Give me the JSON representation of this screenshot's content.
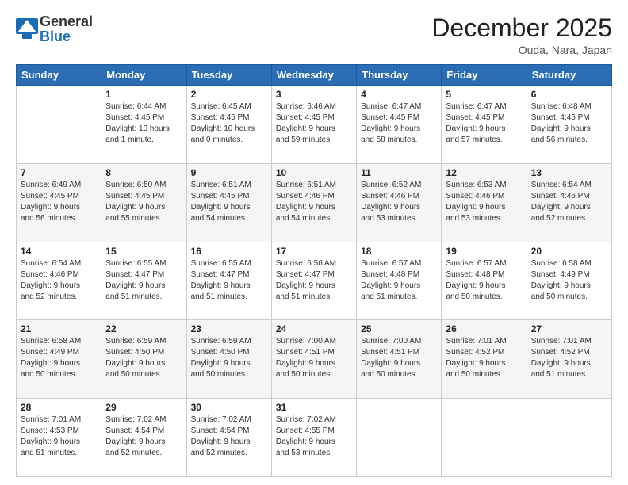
{
  "header": {
    "logo_general": "General",
    "logo_blue": "Blue",
    "month": "December 2025",
    "location": "Ouda, Nara, Japan"
  },
  "days": [
    "Sunday",
    "Monday",
    "Tuesday",
    "Wednesday",
    "Thursday",
    "Friday",
    "Saturday"
  ],
  "weeks": [
    [
      {
        "day": "",
        "info": ""
      },
      {
        "day": "1",
        "info": "Sunrise: 6:44 AM\nSunset: 4:45 PM\nDaylight: 10 hours\nand 1 minute."
      },
      {
        "day": "2",
        "info": "Sunrise: 6:45 AM\nSunset: 4:45 PM\nDaylight: 10 hours\nand 0 minutes."
      },
      {
        "day": "3",
        "info": "Sunrise: 6:46 AM\nSunset: 4:45 PM\nDaylight: 9 hours\nand 59 minutes."
      },
      {
        "day": "4",
        "info": "Sunrise: 6:47 AM\nSunset: 4:45 PM\nDaylight: 9 hours\nand 58 minutes."
      },
      {
        "day": "5",
        "info": "Sunrise: 6:47 AM\nSunset: 4:45 PM\nDaylight: 9 hours\nand 57 minutes."
      },
      {
        "day": "6",
        "info": "Sunrise: 6:48 AM\nSunset: 4:45 PM\nDaylight: 9 hours\nand 56 minutes."
      }
    ],
    [
      {
        "day": "7",
        "info": "Sunrise: 6:49 AM\nSunset: 4:45 PM\nDaylight: 9 hours\nand 56 minutes."
      },
      {
        "day": "8",
        "info": "Sunrise: 6:50 AM\nSunset: 4:45 PM\nDaylight: 9 hours\nand 55 minutes."
      },
      {
        "day": "9",
        "info": "Sunrise: 6:51 AM\nSunset: 4:45 PM\nDaylight: 9 hours\nand 54 minutes."
      },
      {
        "day": "10",
        "info": "Sunrise: 6:51 AM\nSunset: 4:46 PM\nDaylight: 9 hours\nand 54 minutes."
      },
      {
        "day": "11",
        "info": "Sunrise: 6:52 AM\nSunset: 4:46 PM\nDaylight: 9 hours\nand 53 minutes."
      },
      {
        "day": "12",
        "info": "Sunrise: 6:53 AM\nSunset: 4:46 PM\nDaylight: 9 hours\nand 53 minutes."
      },
      {
        "day": "13",
        "info": "Sunrise: 6:54 AM\nSunset: 4:46 PM\nDaylight: 9 hours\nand 52 minutes."
      }
    ],
    [
      {
        "day": "14",
        "info": "Sunrise: 6:54 AM\nSunset: 4:46 PM\nDaylight: 9 hours\nand 52 minutes."
      },
      {
        "day": "15",
        "info": "Sunrise: 6:55 AM\nSunset: 4:47 PM\nDaylight: 9 hours\nand 51 minutes."
      },
      {
        "day": "16",
        "info": "Sunrise: 6:55 AM\nSunset: 4:47 PM\nDaylight: 9 hours\nand 51 minutes."
      },
      {
        "day": "17",
        "info": "Sunrise: 6:56 AM\nSunset: 4:47 PM\nDaylight: 9 hours\nand 51 minutes."
      },
      {
        "day": "18",
        "info": "Sunrise: 6:57 AM\nSunset: 4:48 PM\nDaylight: 9 hours\nand 51 minutes."
      },
      {
        "day": "19",
        "info": "Sunrise: 6:57 AM\nSunset: 4:48 PM\nDaylight: 9 hours\nand 50 minutes."
      },
      {
        "day": "20",
        "info": "Sunrise: 6:58 AM\nSunset: 4:49 PM\nDaylight: 9 hours\nand 50 minutes."
      }
    ],
    [
      {
        "day": "21",
        "info": "Sunrise: 6:58 AM\nSunset: 4:49 PM\nDaylight: 9 hours\nand 50 minutes."
      },
      {
        "day": "22",
        "info": "Sunrise: 6:59 AM\nSunset: 4:50 PM\nDaylight: 9 hours\nand 50 minutes."
      },
      {
        "day": "23",
        "info": "Sunrise: 6:59 AM\nSunset: 4:50 PM\nDaylight: 9 hours\nand 50 minutes."
      },
      {
        "day": "24",
        "info": "Sunrise: 7:00 AM\nSunset: 4:51 PM\nDaylight: 9 hours\nand 50 minutes."
      },
      {
        "day": "25",
        "info": "Sunrise: 7:00 AM\nSunset: 4:51 PM\nDaylight: 9 hours\nand 50 minutes."
      },
      {
        "day": "26",
        "info": "Sunrise: 7:01 AM\nSunset: 4:52 PM\nDaylight: 9 hours\nand 50 minutes."
      },
      {
        "day": "27",
        "info": "Sunrise: 7:01 AM\nSunset: 4:52 PM\nDaylight: 9 hours\nand 51 minutes."
      }
    ],
    [
      {
        "day": "28",
        "info": "Sunrise: 7:01 AM\nSunset: 4:53 PM\nDaylight: 9 hours\nand 51 minutes."
      },
      {
        "day": "29",
        "info": "Sunrise: 7:02 AM\nSunset: 4:54 PM\nDaylight: 9 hours\nand 52 minutes."
      },
      {
        "day": "30",
        "info": "Sunrise: 7:02 AM\nSunset: 4:54 PM\nDaylight: 9 hours\nand 52 minutes."
      },
      {
        "day": "31",
        "info": "Sunrise: 7:02 AM\nSunset: 4:55 PM\nDaylight: 9 hours\nand 53 minutes."
      },
      {
        "day": "",
        "info": ""
      },
      {
        "day": "",
        "info": ""
      },
      {
        "day": "",
        "info": ""
      }
    ]
  ]
}
